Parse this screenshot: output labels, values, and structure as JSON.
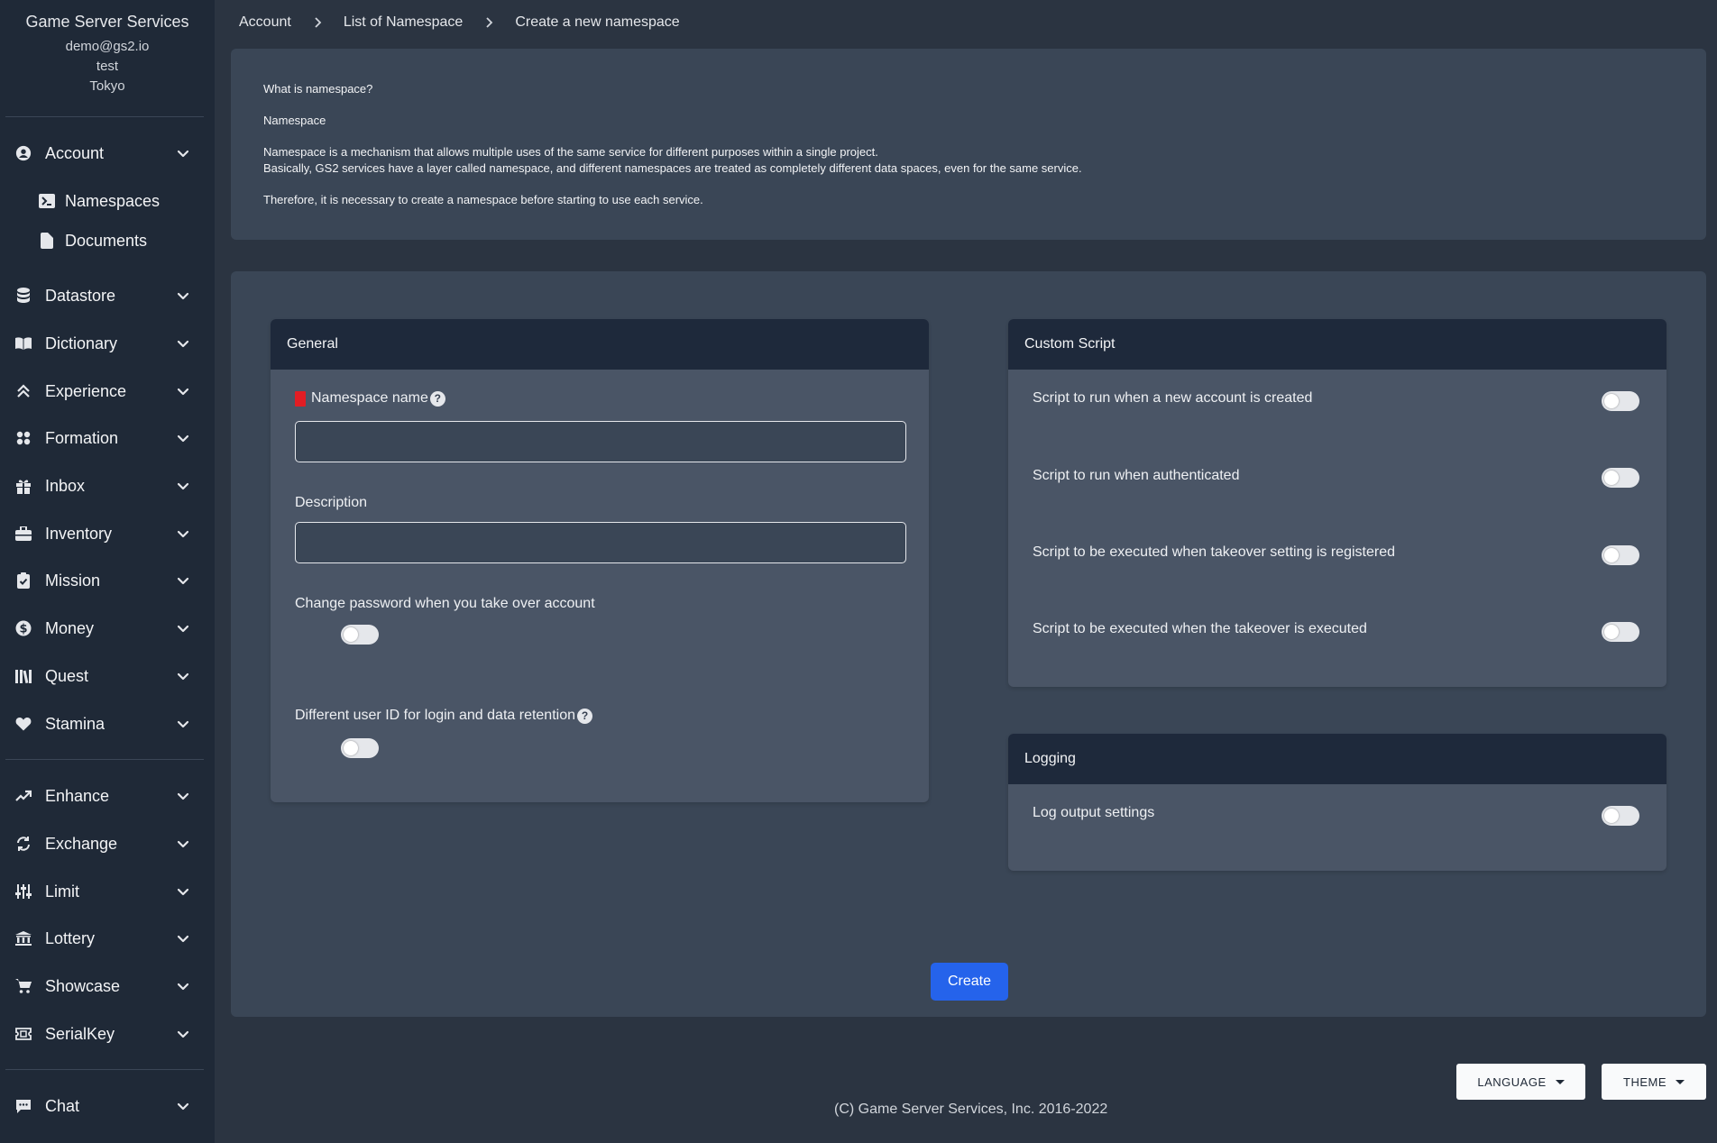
{
  "sidebar": {
    "app_name": "Game Server Services",
    "user_email": "demo@gs2.io",
    "project": "test",
    "region": "Tokyo",
    "items": [
      {
        "label": "Account",
        "icon": "user-circle-icon"
      },
      {
        "label": "Namespaces",
        "icon": "terminal-icon"
      },
      {
        "label": "Documents",
        "icon": "document-icon"
      },
      {
        "label": "Datastore",
        "icon": "database-icon"
      },
      {
        "label": "Dictionary",
        "icon": "book-open-icon"
      },
      {
        "label": "Experience",
        "icon": "chevron-double-up-icon"
      },
      {
        "label": "Formation",
        "icon": "grid-icon"
      },
      {
        "label": "Inbox",
        "icon": "gift-icon"
      },
      {
        "label": "Inventory",
        "icon": "briefcase-icon"
      },
      {
        "label": "Mission",
        "icon": "clipboard-check-icon"
      },
      {
        "label": "Money",
        "icon": "dollar-circle-icon"
      },
      {
        "label": "Quest",
        "icon": "library-icon"
      },
      {
        "label": "Stamina",
        "icon": "heart-icon"
      },
      {
        "label": "Enhance",
        "icon": "trending-up-icon"
      },
      {
        "label": "Exchange",
        "icon": "refresh-icon"
      },
      {
        "label": "Limit",
        "icon": "sliders-icon"
      },
      {
        "label": "Lottery",
        "icon": "bank-icon"
      },
      {
        "label": "Showcase",
        "icon": "shopping-cart-icon"
      },
      {
        "label": "SerialKey",
        "icon": "ticket-icon"
      },
      {
        "label": "Chat",
        "icon": "chat-icon"
      }
    ]
  },
  "breadcrumb": [
    "Account",
    "List of Namespace",
    "Create a new namespace"
  ],
  "info": {
    "question": "What is namespace?",
    "heading": "Namespace",
    "line1": "Namespace is a mechanism that allows multiple uses of the same service for different purposes within a single project.",
    "line2": "Basically, GS2 services have a layer called namespace, and different namespaces are treated as completely different data spaces, even for the same service.",
    "line3": "Therefore, it is necessary to create a namespace before starting to use each service."
  },
  "general": {
    "title": "General",
    "namespace_name_label": "Namespace name",
    "namespace_name_value": "",
    "description_label": "Description",
    "description_value": "",
    "change_password_label": "Change password when you take over account",
    "different_user_id_label": "Different user ID for login and data retention"
  },
  "custom_script": {
    "title": "Custom Script",
    "rows": [
      "Script to run when a new account is created",
      "Script to run when authenticated",
      "Script to be executed when takeover setting is registered",
      "Script to be executed when the takeover is executed"
    ]
  },
  "logging": {
    "title": "Logging",
    "log_output_label": "Log output settings"
  },
  "actions": {
    "create_label": "Create"
  },
  "footer": {
    "language_label": "LANGUAGE",
    "theme_label": "THEME",
    "copyright": "(C) Game Server Services, Inc. 2016-2022"
  },
  "colors": {
    "sidebar_bg": "#1f2937",
    "page_bg": "#2b3441",
    "panel_bg": "#3a4656",
    "card_head_bg": "#1e293b",
    "accent": "#2563eb",
    "required_flag": "#e11d24"
  }
}
